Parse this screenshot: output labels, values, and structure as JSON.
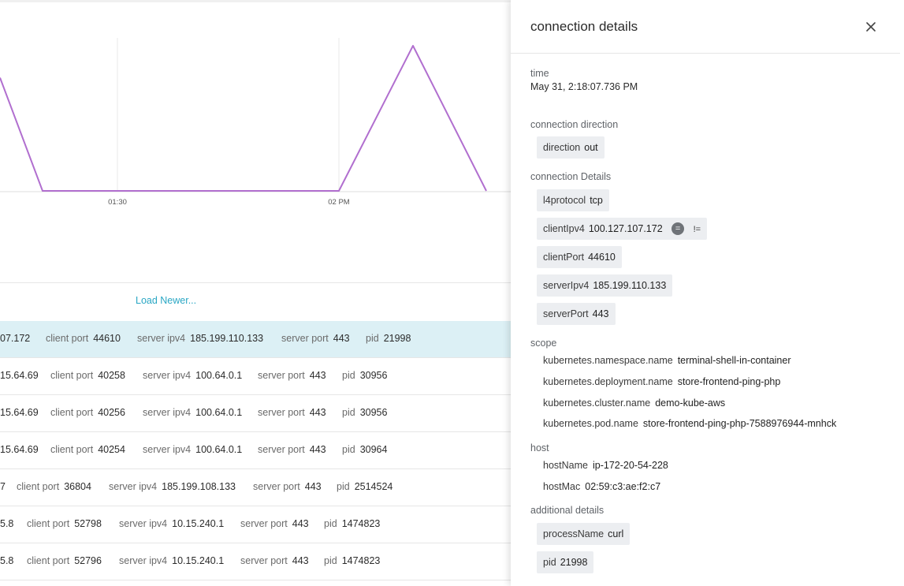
{
  "chart_data": {
    "type": "line",
    "xlabel": "",
    "ylabel": "",
    "x_tick_labels": [
      "01:30",
      "02 PM"
    ],
    "series": [
      {
        "values": [
          0.78,
          0,
          0,
          0,
          1,
          0
        ]
      }
    ],
    "ylim": [
      0,
      1
    ],
    "grid": true,
    "color": "#b16fcf"
  },
  "load_newer_label": "Load Newer...",
  "rows": [
    {
      "client_ipv4": "07.172",
      "client_port": "44610",
      "server_ipv4": "185.199.110.133",
      "server_port": "443",
      "pid": "21998"
    },
    {
      "client_ipv4": "15.64.69",
      "client_port": "40258",
      "server_ipv4": "100.64.0.1",
      "server_port": "443",
      "pid": "30956"
    },
    {
      "client_ipv4": "15.64.69",
      "client_port": "40256",
      "server_ipv4": "100.64.0.1",
      "server_port": "443",
      "pid": "30956"
    },
    {
      "client_ipv4": "15.64.69",
      "client_port": "40254",
      "server_ipv4": "100.64.0.1",
      "server_port": "443",
      "pid": "30964"
    },
    {
      "client_ipv4": "7",
      "client_port": "36804",
      "server_ipv4": "185.199.108.133",
      "server_port": "443",
      "pid": "2514524"
    },
    {
      "client_ipv4": "5.8",
      "client_port": "52798",
      "server_ipv4": "10.15.240.1",
      "server_port": "443",
      "pid": "1474823"
    },
    {
      "client_ipv4": "5.8",
      "client_port": "52796",
      "server_ipv4": "10.15.240.1",
      "server_port": "443",
      "pid": "1474823"
    }
  ],
  "row_labels": {
    "client_port": "client port",
    "server_ipv4": "server ipv4",
    "server_port": "server port",
    "pid": "pid"
  },
  "panel": {
    "title": "connection details",
    "close_icon": "close-icon",
    "time": {
      "label": "time",
      "value": "May 31, 2:18:07.736 PM"
    },
    "connection_direction": {
      "label": "connection direction",
      "key": "direction",
      "value": "out"
    },
    "connection_details": {
      "label": "connection Details",
      "l4protocol": {
        "key": "l4protocol",
        "value": "tcp"
      },
      "clientIpv4": {
        "key": "clientIpv4",
        "value": "100.127.107.172",
        "eq_label": "=",
        "neq_label": "!="
      },
      "clientPort": {
        "key": "clientPort",
        "value": "44610"
      },
      "serverIpv4": {
        "key": "serverIpv4",
        "value": "185.199.110.133"
      },
      "serverPort": {
        "key": "serverPort",
        "value": "443"
      }
    },
    "scope": {
      "label": "scope",
      "namespace": {
        "key": "kubernetes.namespace.name",
        "value": "terminal-shell-in-container"
      },
      "deployment": {
        "key": "kubernetes.deployment.name",
        "value": "store-frontend-ping-php"
      },
      "cluster": {
        "key": "kubernetes.cluster.name",
        "value": "demo-kube-aws"
      },
      "pod": {
        "key": "kubernetes.pod.name",
        "value": "store-frontend-ping-php-7588976944-mnhck"
      }
    },
    "host": {
      "label": "host",
      "hostName": {
        "key": "hostName",
        "value": "ip-172-20-54-228"
      },
      "hostMac": {
        "key": "hostMac",
        "value": "02:59:c3:ae:f2:c7"
      }
    },
    "additional_details": {
      "label": "additional details",
      "processName": {
        "key": "processName",
        "value": "curl"
      },
      "pid": {
        "key": "pid",
        "value": "21998"
      }
    }
  }
}
